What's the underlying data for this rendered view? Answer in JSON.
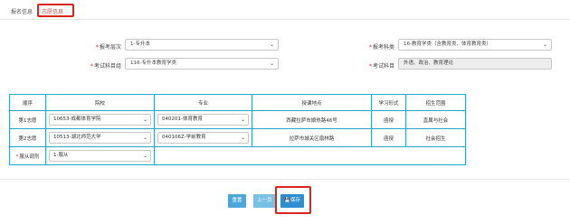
{
  "tabs": [
    {
      "label": "报名信息"
    },
    {
      "label": "志愿信息"
    }
  ],
  "form": {
    "level_label": "报考层次",
    "level_value": "1-专升本",
    "subject_label": "报考科类",
    "subject_value": "16-教育学类（含教育类、体育教育类）",
    "exam_plan_label": "考试科目组",
    "exam_plan_value": "116-专升本教育学类",
    "exam_subjects_label": "考试科目",
    "exam_subjects_value": "外语、政治、教育理论"
  },
  "table": {
    "headers": [
      "顺序",
      "院校",
      "专业",
      "授课地点",
      "学习形式",
      "招生范围"
    ],
    "rows": [
      {
        "order": "第1志愿",
        "school": "10653-成都体育学院",
        "major": "040201-体育教育",
        "location": "西藏拉萨市娘热路46号",
        "mode": "函授",
        "scope": "直属与社会"
      },
      {
        "order": "第2志愿",
        "school": "10513-湖北师范大学",
        "major": "040106Z-学前教育",
        "location": "拉萨市城关区扇林路",
        "mode": "函授",
        "scope": "社会招生"
      }
    ],
    "adjust_label": "服从调剂",
    "adjust_value": "1-服从"
  },
  "buttons": {
    "reset": "重置",
    "prev": "上一页",
    "save": "保存"
  },
  "colors": {
    "highlight": "#d9241c",
    "table_border": "#2aa7c8",
    "save_button": "#2b8fd1"
  }
}
